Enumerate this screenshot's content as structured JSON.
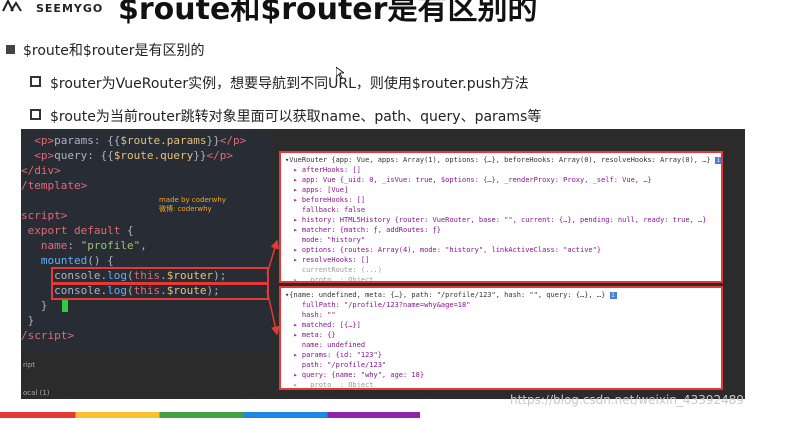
{
  "header": {
    "logo_text": "SEEMYGO",
    "title": "$route和$router是有区别的"
  },
  "bullets": {
    "main": "$route和$router是有区别的",
    "sub1": "$router为VueRouter实例，想要导航到不同URL，则使用$router.push方法",
    "sub2": "$route为当前router跳转对象里面可以获取name、path、query、params等"
  },
  "code": {
    "lines": [
      "  <p>params: {{$route.params}}</p>",
      "  <p>query: {{$route.query}}</p>",
      "</div>",
      "/template>",
      "",
      "script>",
      " export default {",
      "   name: \"profile\",",
      "   mounted() {",
      "     console.log(this.$router);",
      "     console.log(this.$route);",
      "   }",
      " }",
      "/script>"
    ],
    "watermark_line1": "made by coderwhy",
    "watermark_line2": "微博: coderwhy",
    "tree_label1": "ript",
    "tree_label2": "ocal (1)"
  },
  "router_console": {
    "lines": [
      "▾VueRouter {app: Vue, apps: Array(1), options: {…}, beforeHooks: Array(0), resolveHooks: Array(0), …}",
      "  ▸ afterHooks: []",
      "  ▸ app: Vue {_uid: 0, _isVue: true, $options: {…}, _renderProxy: Proxy, _self: Vue, …}",
      "  ▸ apps: [Vue]",
      "  ▸ beforeHooks: []",
      "    fallback: false",
      "  ▸ history: HTML5History {router: VueRouter, base: \"\", current: {…}, pending: null, ready: true, …}",
      "  ▸ matcher: {match: ƒ, addRoutes: ƒ}",
      "    mode: \"history\"",
      "  ▸ options: {routes: Array(4), mode: \"history\", linkActiveClass: \"active\"}",
      "  ▸ resolveHooks: []",
      "    currentRoute: (...)",
      "  ▸ __proto__: Object"
    ]
  },
  "route_console": {
    "lines": [
      "▾{name: undefined, meta: {…}, path: \"/profile/123\", hash: \"\", query: {…}, …}",
      "    fullPath: \"/profile/123?name=why&age=18\"",
      "    hash: \"\"",
      "  ▸ matched: [{…}]",
      "  ▸ meta: {}",
      "    name: undefined",
      "  ▸ params: {id: \"123\"}",
      "    path: \"/profile/123\"",
      "  ▸ query: {name: \"why\", age: 18}",
      "  ▸ __proto__: Object"
    ]
  },
  "footer": {
    "url_watermark": "https://blog.csdn.net/weixin_43392489"
  },
  "colors": {
    "accent_red": "#e53935",
    "code_bg": "#282c34",
    "highlight_green": "#2ecc40"
  }
}
